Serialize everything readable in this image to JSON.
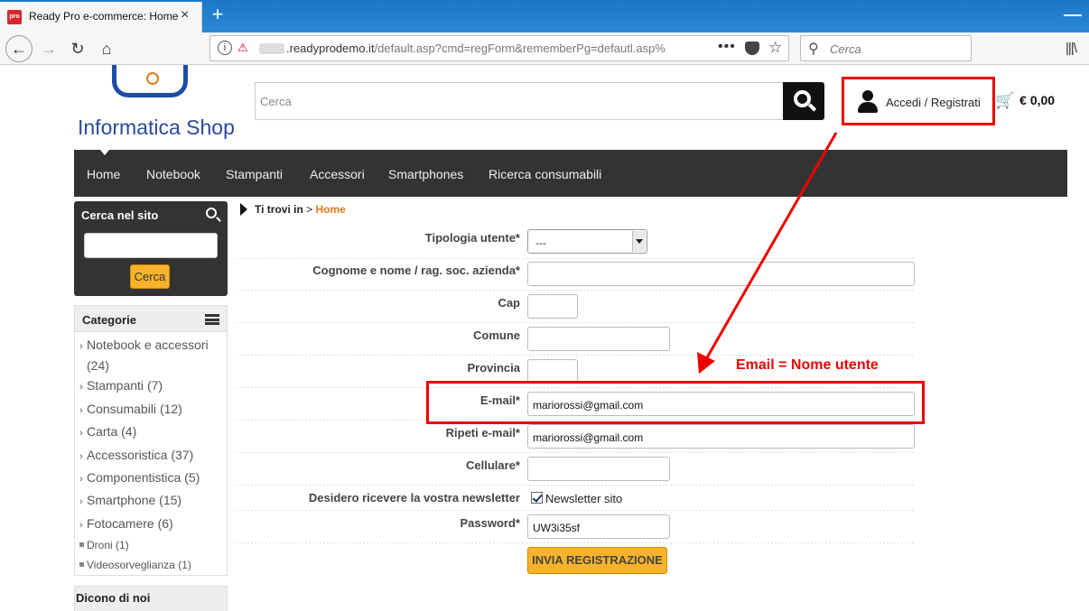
{
  "browser": {
    "tab_title": "Ready Pro e-commerce: Home",
    "tab_favicon": "pro",
    "url_host": ".readyprodemo.it",
    "url_path": "/default.asp?cmd=regForm&rememberPg=defautl.asp%",
    "search_placeholder": "Cerca",
    "icons": [
      "back-icon",
      "forward-icon",
      "reload-icon",
      "home-icon",
      "info-icon",
      "insecure-lock-icon",
      "page-actions-icon",
      "pocket-icon",
      "bookmark-star-icon",
      "search-icon",
      "library-icon"
    ]
  },
  "header": {
    "logo_text": "Informatica Shop",
    "search_placeholder": "Cerca",
    "login_label": "Accedi / Registrati",
    "cart_total": "€ 0,00"
  },
  "menu": [
    "Home",
    "Notebook",
    "Stampanti",
    "Accessori",
    "Smartphones",
    "Ricerca consumabili"
  ],
  "sidebar": {
    "search_title": "Cerca nel sito",
    "search_button": "Cerca",
    "categories_title": "Categorie",
    "categories": [
      {
        "name": "Notebook e accessori",
        "count": "(24)"
      },
      {
        "name": "Stampanti",
        "count": "(7)"
      },
      {
        "name": "Consumabili",
        "count": "(12)"
      },
      {
        "name": "Carta",
        "count": "(4)"
      },
      {
        "name": "Accessoristica",
        "count": "(37)"
      },
      {
        "name": "Componentistica",
        "count": "(5)"
      },
      {
        "name": "Smartphone",
        "count": "(15)"
      },
      {
        "name": "Fotocamere",
        "count": "(6)"
      }
    ],
    "subcategories": [
      {
        "name": "Droni",
        "count": "(1)"
      },
      {
        "name": "Videosorveglianza",
        "count": "(1)"
      }
    ],
    "reviews_title": "Dicono di noi"
  },
  "breadcrumb": {
    "prefix": "Ti trovi in",
    "separator": ">",
    "current": "Home"
  },
  "form": {
    "fields": [
      {
        "label": "Tipologia utente*",
        "value": "---"
      },
      {
        "label": "Cognome e nome / rag. soc. azienda*",
        "value": ""
      },
      {
        "label": "Cap",
        "value": ""
      },
      {
        "label": "Comune",
        "value": ""
      },
      {
        "label": "Provincia",
        "value": ""
      },
      {
        "label": "E-mail*",
        "value": "mariorossi@gmail.com"
      },
      {
        "label": "Ripeti e-mail*",
        "value": "mariorossi@gmail.com"
      },
      {
        "label": "Cellulare*",
        "value": ""
      },
      {
        "label": "Desidero ricevere la vostra newsletter",
        "value": "Newsletter sito",
        "checked": true
      },
      {
        "label": "Password*",
        "value": "UW3i35sf"
      }
    ],
    "submit_label": "INVIA REGISTRAZIONE"
  },
  "annotation": {
    "label": "Email = Nome utente",
    "color": "#e00000"
  },
  "colors": {
    "accent": "#f8b32a",
    "menu_bg": "#333333",
    "annotation": "#e00000",
    "breadcrumb_home": "#e07b1a",
    "logo": "#2a4b9b"
  }
}
